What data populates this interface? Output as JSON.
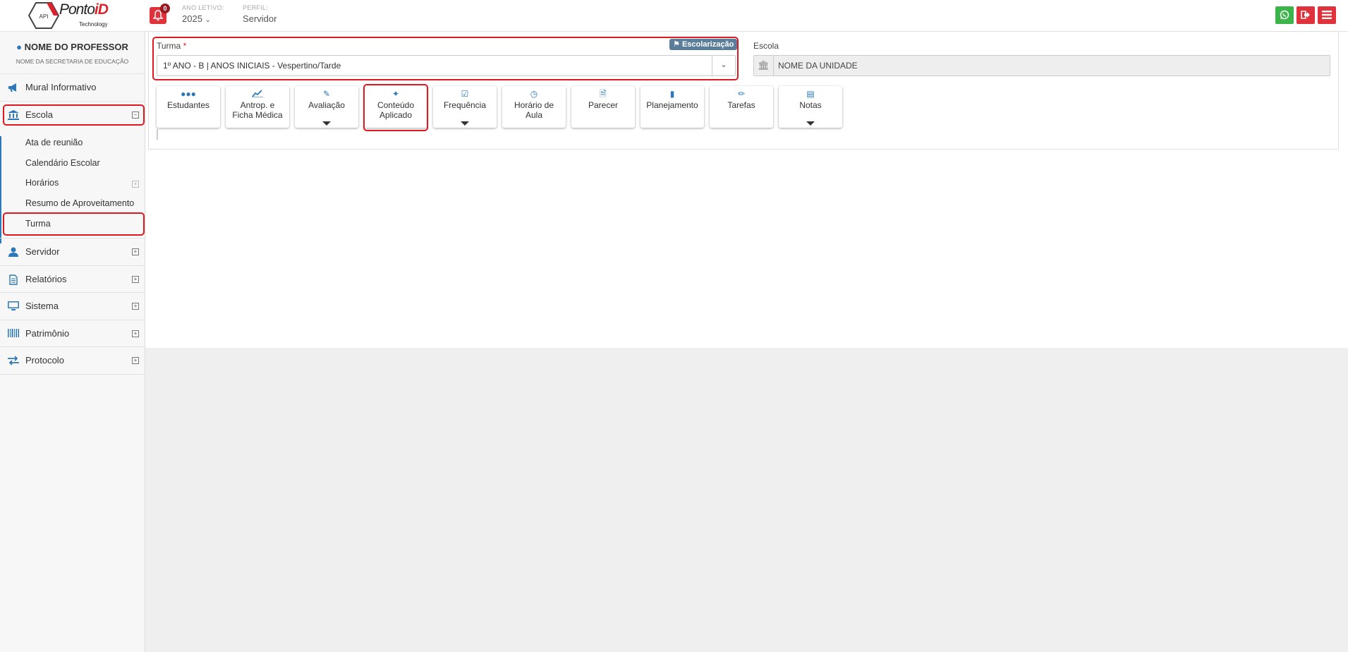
{
  "topbar": {
    "logo_main": "Ponto",
    "logo_accent": "iD",
    "logo_sub": "Technology",
    "logo_hex_text": "API",
    "notification_count": "0",
    "ano_letivo_label": "ANO LETIVO:",
    "ano_letivo_value": "2025",
    "perfil_label": "PERFIL:",
    "perfil_value": "Servidor",
    "colors": {
      "whatsapp": "#3bb54a",
      "logout": "#e0323b",
      "menu": "#e0323b"
    }
  },
  "sidebar": {
    "professor_name": "NOME DO PROFESSOR",
    "secretaria": "NOME DA SECRETARIA DE EDUCAÇÃO",
    "items": [
      {
        "label": "Mural Informativo",
        "icon": "megaphone-icon"
      },
      {
        "label": "Escola",
        "icon": "bank-icon",
        "expander": "−"
      },
      {
        "label": "Servidor",
        "icon": "user-icon",
        "expander": "+"
      },
      {
        "label": "Relatórios",
        "icon": "document-icon",
        "expander": "+"
      },
      {
        "label": "Sistema",
        "icon": "monitor-icon",
        "expander": "+"
      },
      {
        "label": "Patrimônio",
        "icon": "barcode-icon",
        "expander": "+"
      },
      {
        "label": "Protocolo",
        "icon": "exchange-icon",
        "expander": "+"
      }
    ],
    "escola_sub": [
      {
        "label": "Ata de reunião"
      },
      {
        "label": "Calendário Escolar"
      },
      {
        "label": "Horários",
        "expander": "+"
      },
      {
        "label": "Resumo de Aproveitamento"
      },
      {
        "label": "Turma"
      }
    ]
  },
  "form": {
    "turma_label": "Turma",
    "turma_required": "*",
    "turma_tag": "Escolarização",
    "turma_value": "1º ANO - B | ANOS INICIAIS - Vespertino/Tarde",
    "escola_label": "Escola",
    "escola_value": "NOME DA UNIDADE"
  },
  "actions": [
    {
      "label": "Estudantes",
      "icon": "users-icon"
    },
    {
      "label": "Antrop. e Ficha Médica",
      "icon": "line-chart-icon"
    },
    {
      "label": "Avaliação",
      "icon": "edit-icon",
      "dropdown": true
    },
    {
      "label": "Conteúdo Aplicado",
      "icon": "magic-wand-icon"
    },
    {
      "label": "Frequência",
      "icon": "check-square-icon",
      "dropdown": true
    },
    {
      "label": "Horário de Aula",
      "icon": "clock-icon"
    },
    {
      "label": "Parecer",
      "icon": "file-icon"
    },
    {
      "label": "Planejamento",
      "icon": "book-icon"
    },
    {
      "label": "Tarefas",
      "icon": "pencil-icon"
    },
    {
      "label": "Notas",
      "icon": "list-icon",
      "dropdown": true
    }
  ],
  "colors": {
    "accent": "#2c78b8",
    "highlight": "#e0181f"
  }
}
